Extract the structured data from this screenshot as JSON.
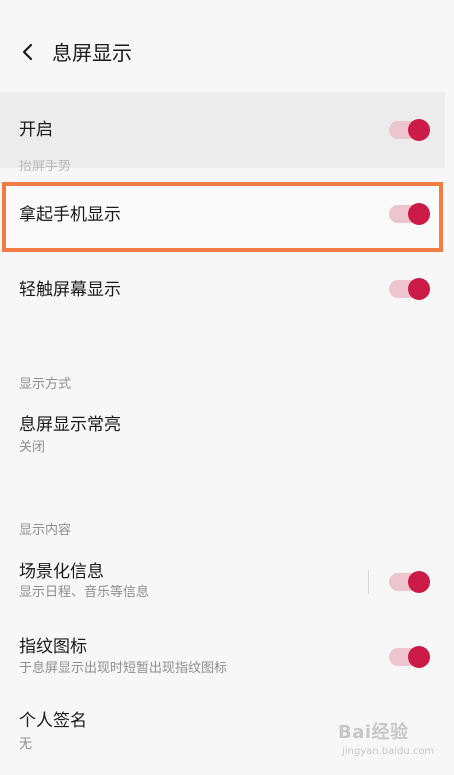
{
  "header": {
    "title": "息屏显示",
    "back_icon": "chevron-left-icon"
  },
  "peek_text": "抬屏手势",
  "settings": {
    "enable": {
      "label": "开启",
      "on": true
    },
    "lift_display": {
      "label": "拿起手机显示",
      "on": true
    },
    "tap_display": {
      "label": "轻触屏幕显示",
      "on": true
    }
  },
  "display_mode": {
    "section_title": "显示方式",
    "always_on": {
      "label": "息屏显示常亮",
      "value": "关闭"
    }
  },
  "display_content": {
    "section_title": "显示内容",
    "scenario": {
      "label": "场景化信息",
      "desc": "显示日程、音乐等信息",
      "on": true
    },
    "fingerprint": {
      "label": "指纹图标",
      "desc": "于息屏显示出现时短暂出现指纹图标",
      "on": true
    },
    "signature": {
      "label": "个人签名",
      "value": "无"
    }
  },
  "watermark": {
    "main": "Bai经验",
    "sub": "jingyan.baidu.com"
  },
  "colors": {
    "accent": "#cb1a45",
    "track": "#ecc5cf",
    "highlight_border": "#f27d44"
  }
}
